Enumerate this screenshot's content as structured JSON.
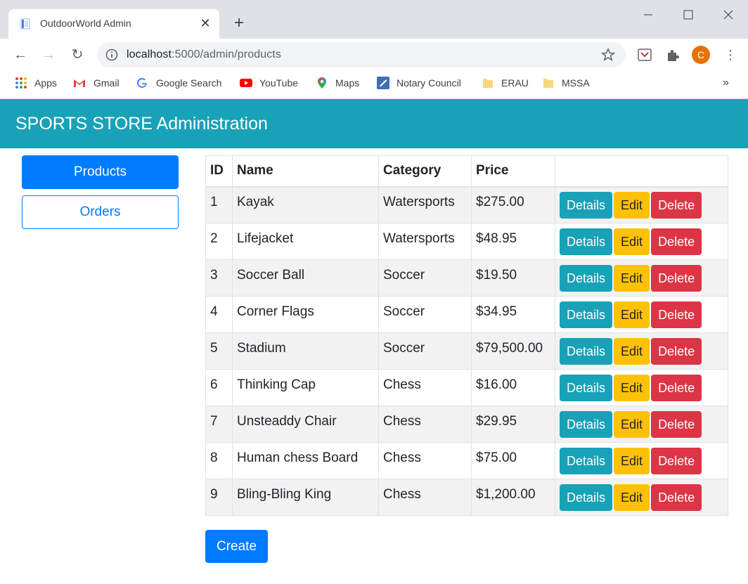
{
  "browser": {
    "tab_title": "OutdoorWorld Admin",
    "url_host": "localhost",
    "url_path": ":5000/admin/products",
    "avatar_letter": "C",
    "bookmarks": [
      {
        "label": "Apps",
        "icon": "apps-grid-icon"
      },
      {
        "label": "Gmail",
        "icon": "gmail-icon"
      },
      {
        "label": "Google Search",
        "icon": "google-icon"
      },
      {
        "label": "YouTube",
        "icon": "youtube-icon"
      },
      {
        "label": "Maps",
        "icon": "maps-icon"
      },
      {
        "label": "Notary Council",
        "icon": "notary-icon"
      },
      {
        "label": "ERAU",
        "icon": "folder-icon"
      },
      {
        "label": "MSSA",
        "icon": "folder-icon"
      }
    ],
    "bookmarks_overflow": "»"
  },
  "header": {
    "title": "SPORTS STORE Administration",
    "color": "#17a2b8"
  },
  "sidebar": {
    "products_label": "Products",
    "orders_label": "Orders"
  },
  "table": {
    "columns": [
      "ID",
      "Name",
      "Category",
      "Price",
      ""
    ],
    "rows": [
      {
        "id": "1",
        "name": "Kayak",
        "category": "Watersports",
        "price": "$275.00"
      },
      {
        "id": "2",
        "name": "Lifejacket",
        "category": "Watersports",
        "price": "$48.95"
      },
      {
        "id": "3",
        "name": "Soccer Ball",
        "category": "Soccer",
        "price": "$19.50"
      },
      {
        "id": "4",
        "name": "Corner Flags",
        "category": "Soccer",
        "price": "$34.95"
      },
      {
        "id": "5",
        "name": "Stadium",
        "category": "Soccer",
        "price": "$79,500.00"
      },
      {
        "id": "6",
        "name": "Thinking Cap",
        "category": "Chess",
        "price": "$16.00"
      },
      {
        "id": "7",
        "name": "Unsteaddy Chair",
        "category": "Chess",
        "price": "$29.95"
      },
      {
        "id": "8",
        "name": "Human chess Board",
        "category": "Chess",
        "price": "$75.00"
      },
      {
        "id": "9",
        "name": "Bling-Bling King",
        "category": "Chess",
        "price": "$1,200.00"
      }
    ],
    "actions": {
      "details": "Details",
      "edit": "Edit",
      "delete": "Delete"
    }
  },
  "create_label": "Create",
  "colors": {
    "primary": "#007bff",
    "info": "#17a2b8",
    "warning": "#ffc107",
    "danger": "#dc3545"
  }
}
